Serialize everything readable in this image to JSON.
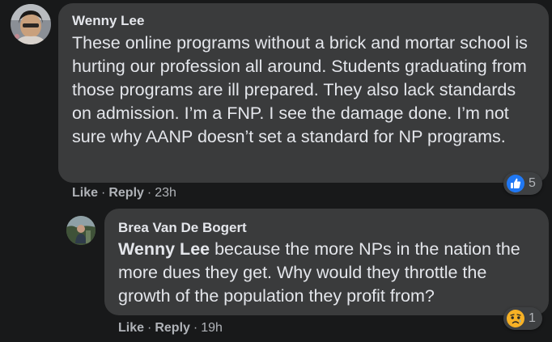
{
  "comments": [
    {
      "author": "Wenny Lee",
      "text": "These online programs without a brick and mortar school is hurting our profession all around. Students graduating from those programs are ill prepared. They also lack standards on admission. I’m a FNP. I see the damage done. I’m not sure why AANP doesn’t set a standard for NP programs.",
      "actions": {
        "like": "Like",
        "reply": "Reply",
        "time": "23h",
        "separator": "·"
      },
      "reaction": {
        "icon": "like-thumbs-up-icon",
        "count": "5"
      }
    },
    {
      "author": "Brea Van De Bogert",
      "mention": "Wenny Lee",
      "text": " because the more NPs in the nation the more dues they get. Why would they throttle the growth of the population they profit from?",
      "actions": {
        "like": "Like",
        "reply": "Reply",
        "time": "19h",
        "separator": "·"
      },
      "reaction": {
        "icon": "sad-face-icon",
        "count": "1"
      }
    }
  ],
  "colors": {
    "background": "#18191a",
    "bubble": "#3a3b3c",
    "text": "#e4e6eb",
    "secondary_text": "#b0b3b8",
    "like_blue": "#2078f4",
    "sad_yellow": "#f7b125"
  }
}
